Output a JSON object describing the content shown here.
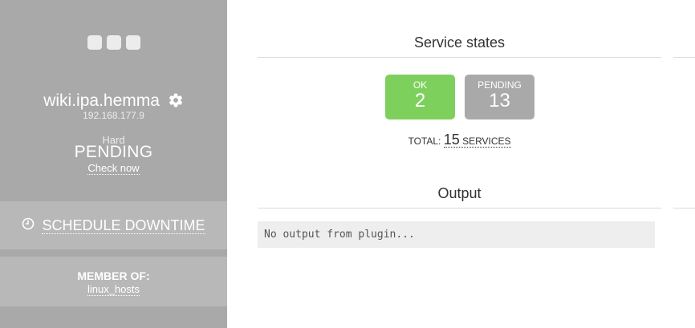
{
  "host": {
    "state_dots": [
      "state-dot-1",
      "state-dot-2",
      "state-dot-3"
    ],
    "name": "wiki.ipa.hemma",
    "address": "192.168.177.9",
    "state_type": "Hard",
    "state": "PENDING",
    "check_now_label": "Check now"
  },
  "actions": {
    "schedule_downtime_label": "SCHEDULE DOWNTIME"
  },
  "membership": {
    "title": "MEMBER OF:",
    "groups": [
      "linux_hosts"
    ]
  },
  "service_states": {
    "title": "Service states",
    "badges": [
      {
        "label": "OK",
        "count": "2",
        "color": "#7ed05d"
      },
      {
        "label": "PENDING",
        "count": "13",
        "color": "#a9a9a9"
      }
    ],
    "total_prefix": "TOTAL:",
    "total_count": "15",
    "total_suffix": "SERVICES"
  },
  "output": {
    "title": "Output",
    "text": "No output from plugin..."
  },
  "colors": {
    "sidebar_bg": "#a9a9a9",
    "block_bg": "#b8b8b8",
    "ok": "#7ed05d",
    "pending": "#a9a9a9"
  }
}
